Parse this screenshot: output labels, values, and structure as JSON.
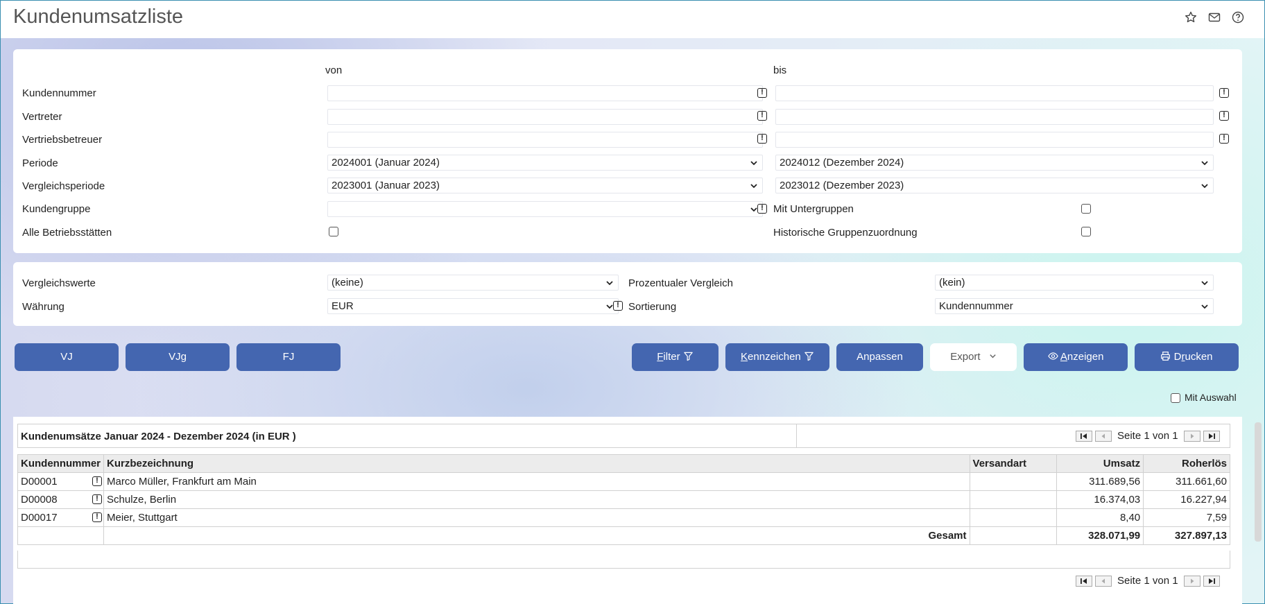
{
  "page": {
    "title": "Kundenumsatzliste"
  },
  "header_icons": [
    "star-icon",
    "mail-icon",
    "help-icon"
  ],
  "filters": {
    "col_from": "von",
    "col_to": "bis",
    "rows": {
      "kundennummer": "Kundennummer",
      "vertreter": "Vertreter",
      "vertriebsbetreuer": "Vertriebsbetreuer",
      "periode": "Periode",
      "vergleichsperiode": "Vergleichsperiode",
      "kundengruppe": "Kundengruppe",
      "alle_betriebsstaetten": "Alle Betriebsstätten"
    },
    "periode_from": "2024001 (Januar 2024)",
    "periode_to": "2024012 (Dezember 2024)",
    "vergleich_from": "2023001 (Januar 2023)",
    "vergleich_to": "2023012 (Dezember 2023)",
    "kundengruppe_value": "",
    "mit_untergruppen": "Mit Untergruppen",
    "historische": "Historische Gruppenzuordnung"
  },
  "options": {
    "vergleichswerte_label": "Vergleichswerte",
    "vergleichswerte_value": "(keine)",
    "waehrung_label": "Währung",
    "waehrung_value": "EUR",
    "prozentual_label": "Prozentualer Vergleich",
    "prozentual_value": "(kein)",
    "sortierung_label": "Sortierung",
    "sortierung_value": "Kundennummer"
  },
  "buttons": {
    "vj": "VJ",
    "vjg": "VJg",
    "fj": "FJ",
    "filter_first": "F",
    "filter_rest": "ilter",
    "kennzeichen_first": "K",
    "kennzeichen_rest": "ennzeichen",
    "anpassen": "Anpassen",
    "export": "Export",
    "anzeigen_first": "A",
    "anzeigen_rest": "nzeigen",
    "drucken_pre": "D",
    "drucken_u": "r",
    "drucken_rest": "ucken"
  },
  "mit_auswahl": "Mit Auswahl",
  "table": {
    "caption": "Kundenumsätze Januar 2024 - Dezember 2024 (in EUR )",
    "pager_text": "Seite 1 von 1",
    "columns": [
      "Kundennummer",
      "Kurzbezeichnung",
      "Versandart",
      "Umsatz",
      "Roherlös"
    ],
    "rows": [
      {
        "kundennummer": "D00001",
        "kurz": "Marco Müller, Frankfurt am Main",
        "versandart": "",
        "umsatz": "311.689,56",
        "roherloes": "311.661,60"
      },
      {
        "kundennummer": "D00008",
        "kurz": "Schulze, Berlin",
        "versandart": "",
        "umsatz": "16.374,03",
        "roherloes": "16.227,94"
      },
      {
        "kundennummer": "D00017",
        "kurz": "Meier, Stuttgart",
        "versandart": "",
        "umsatz": "8,40",
        "roherloes": "7,59"
      }
    ],
    "total_label": "Gesamt",
    "total_umsatz": "328.071,99",
    "total_roherloes": "327.897,13"
  }
}
